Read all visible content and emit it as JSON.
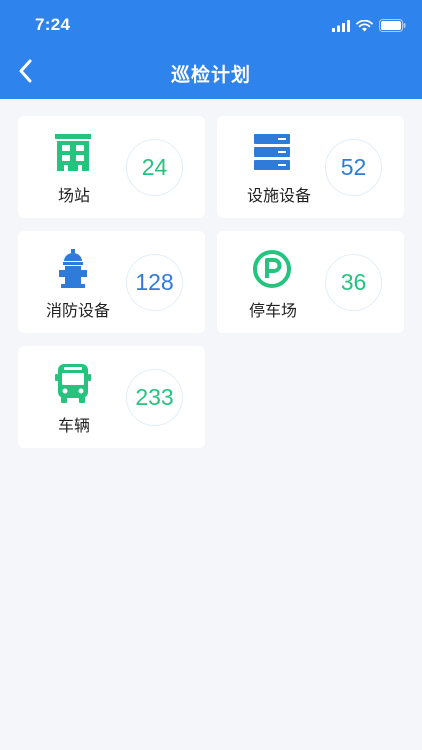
{
  "status_bar": {
    "time": "7:24"
  },
  "header": {
    "title": "巡检计划"
  },
  "colors": {
    "header": "#2e83ec",
    "green": "#24c47e",
    "blue": "#2e7bd9"
  },
  "cards": [
    {
      "label": "场站",
      "count": "24",
      "icon": "station-icon"
    },
    {
      "label": "设施设备",
      "count": "52",
      "icon": "server-icon"
    },
    {
      "label": "消防设备",
      "count": "128",
      "icon": "fire-hydrant-icon"
    },
    {
      "label": "停车场",
      "count": "36",
      "icon": "parking-icon"
    },
    {
      "label": "车辆",
      "count": "233",
      "icon": "bus-icon"
    }
  ]
}
